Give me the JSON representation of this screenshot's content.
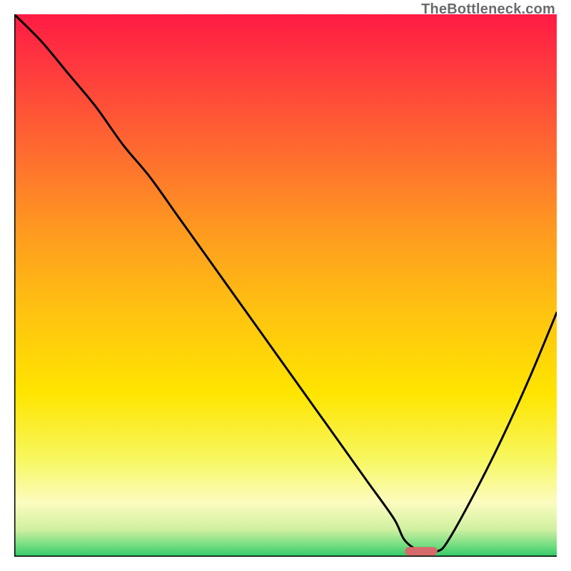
{
  "watermark": "TheBottleneck.com",
  "chart_data": {
    "type": "line",
    "title": "",
    "xlabel": "",
    "ylabel": "",
    "xlim": [
      0,
      100
    ],
    "ylim": [
      0,
      100
    ],
    "x": [
      0,
      5,
      10,
      15,
      20,
      25,
      30,
      35,
      40,
      45,
      50,
      55,
      60,
      65,
      70,
      72,
      75,
      78,
      80,
      85,
      90,
      95,
      100
    ],
    "values": [
      100,
      95,
      89,
      83,
      76,
      70,
      63,
      56,
      49,
      42,
      35,
      28,
      21,
      14,
      7,
      3,
      1,
      1,
      3,
      12,
      22,
      33,
      45
    ],
    "annotations": [
      {
        "type": "marker",
        "x_range": [
          72,
          78
        ],
        "y": 1,
        "color": "#d66a6a"
      }
    ],
    "background": {
      "type": "vertical-gradient",
      "stops": [
        {
          "offset": 0.0,
          "color": "#ff1b44"
        },
        {
          "offset": 0.1,
          "color": "#ff3a3e"
        },
        {
          "offset": 0.25,
          "color": "#ff6a30"
        },
        {
          "offset": 0.4,
          "color": "#ff9a20"
        },
        {
          "offset": 0.55,
          "color": "#ffc310"
        },
        {
          "offset": 0.7,
          "color": "#ffe500"
        },
        {
          "offset": 0.82,
          "color": "#f7f760"
        },
        {
          "offset": 0.9,
          "color": "#fcfcbf"
        },
        {
          "offset": 0.95,
          "color": "#d0f0a0"
        },
        {
          "offset": 0.98,
          "color": "#70dd80"
        },
        {
          "offset": 1.0,
          "color": "#30c968"
        }
      ]
    }
  }
}
